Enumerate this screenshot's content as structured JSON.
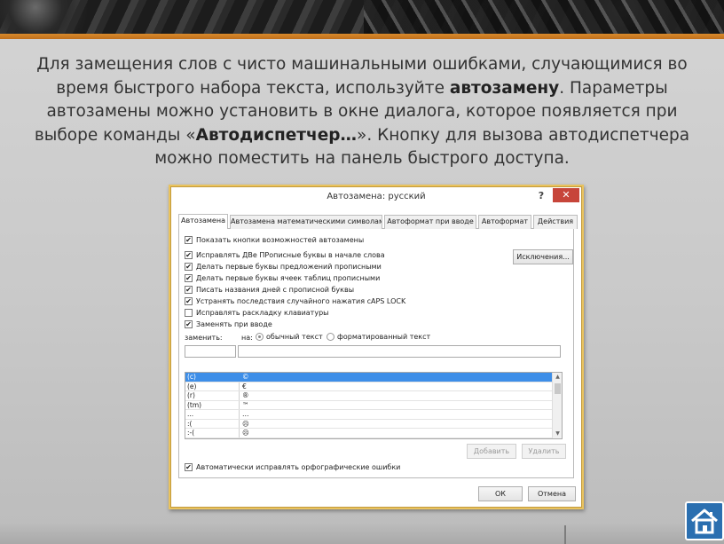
{
  "slide": {
    "intro_part1": "Для замещения слов с чисто машинальными ошибками, случающимися во время быстрого набора текста, используйте ",
    "intro_bold1": "автозамену",
    "intro_part2": ". Параметры автозамены можно установить в окне диалога, которое появляется при выборе команды «",
    "intro_bold2": "Автодиспетчер…",
    "intro_part3": "». Кнопку для вызова автодиспетчера можно поместить на панель быстрого доступа."
  },
  "dialog": {
    "title": "Автозамена: русский",
    "help": "?",
    "close": "✕",
    "tabs": [
      {
        "label": "Автозамена"
      },
      {
        "label": "Автозамена математическими символами"
      },
      {
        "label": "Автоформат при вводе"
      },
      {
        "label": "Автоформат"
      },
      {
        "label": "Действия"
      }
    ],
    "show_buttons": {
      "label": "Показать кнопки возможностей автозамены",
      "checked": true
    },
    "options": [
      {
        "label": "Исправлять ДВе ПРописные буквы в начале слова",
        "checked": true
      },
      {
        "label": "Делать первые буквы предложений прописными",
        "checked": true
      },
      {
        "label": "Делать первые буквы ячеек таблиц прописными",
        "checked": true
      },
      {
        "label": "Писать названия дней с прописной буквы",
        "checked": true
      },
      {
        "label": "Устранять последствия случайного нажатия cAPS LOCK",
        "checked": true
      },
      {
        "label": "Исправлять раскладку клавиатуры",
        "checked": false
      },
      {
        "label": "Заменять при вводе",
        "checked": true
      }
    ],
    "exceptions_button": "Исключения...",
    "replace_label": "заменить:",
    "with_label": "на:",
    "radio_plain": "обычный текст",
    "radio_formatted": "форматированный текст",
    "replace_value": "",
    "with_value": "",
    "list": [
      {
        "from": "(c)",
        "to": "©"
      },
      {
        "from": "(e)",
        "to": "€"
      },
      {
        "from": "(r)",
        "to": "®"
      },
      {
        "from": "(tm)",
        "to": "™"
      },
      {
        "from": "...",
        "to": "…"
      },
      {
        "from": ":(",
        "to": "☹"
      },
      {
        "from": ":-(",
        "to": "☹"
      }
    ],
    "add_button": "Добавить",
    "delete_button": "Удалить",
    "spellcheck": {
      "label": "Автоматически исправлять орфографические ошибки",
      "checked": true
    },
    "ok_button": "ОК",
    "cancel_button": "Отмена"
  },
  "colors": {
    "accent_bar": "#d98a2b",
    "dialog_border": "#e9c35f",
    "selection": "#3d8ee8",
    "close_button": "#c7453a",
    "home_button": "#2a6fb0"
  },
  "icons": {
    "home": "home-icon"
  }
}
